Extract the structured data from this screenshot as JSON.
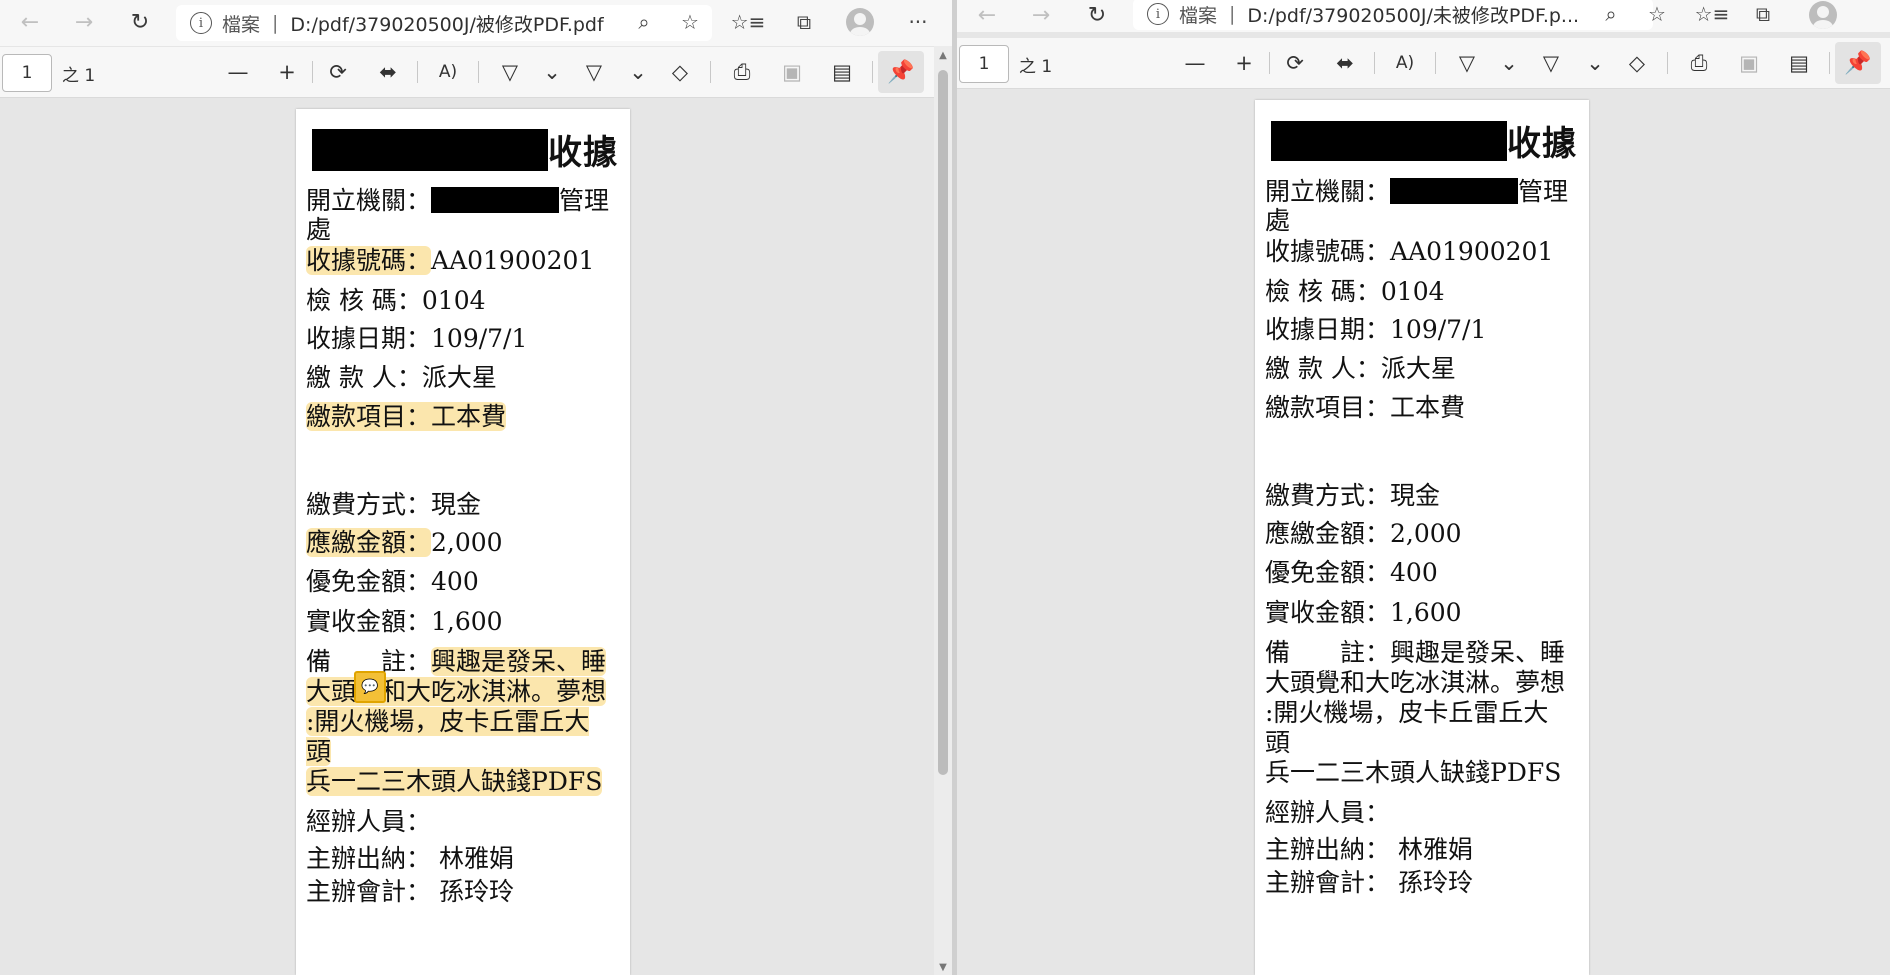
{
  "left": {
    "address": {
      "scheme": "檔案",
      "separator": "|",
      "path": "D:/pdf/379020500J/被修改PDF.pdf"
    },
    "toolbar": {
      "page_value": "1",
      "page_count": "之 1"
    },
    "doc": {
      "title": "收據",
      "agency_label": "開立機關：",
      "agency_suffix": "管理",
      "agency_wrap": "處",
      "receipt_no_label": "收據號碼：",
      "receipt_no": "AA01900201",
      "check_code_label": "檢 核 碼：",
      "check_code": "0104",
      "date_label": "收據日期：",
      "date": "109/7/1",
      "payer_label": "繳 款 人：",
      "payer": "派大星",
      "item_label": "繳款項目：",
      "item": "工本費",
      "method_label": "繳費方式：",
      "method": "現金",
      "due_label": "應繳金額：",
      "due": "2,000",
      "discount_label": "優免金額：",
      "discount": "400",
      "actual_label": "實收金額：",
      "actual": "1,600",
      "note_label": "備　　註：",
      "note_l1": "興趣是發呆、睡",
      "note_l2": "大頭覺和大吃冰淇淋。夢想",
      "note_l3": ":開火機場，皮卡丘雷丘大頭",
      "note_l4": "兵一二三木頭人缺錢PDFS",
      "handler_label": "經辦人員：",
      "cashier_label": "主辦出納：",
      "cashier": "林雅娟",
      "accountant_label": "主辦會計：",
      "accountant": "孫玲玲"
    }
  },
  "right": {
    "address": {
      "scheme": "檔案",
      "separator": "|",
      "path": "D:/pdf/379020500J/未被修改PDF.p..."
    },
    "toolbar": {
      "page_value": "1",
      "page_count": "之 1"
    },
    "doc": {
      "title": "收據",
      "agency_label": "開立機關：",
      "agency_suffix": "管理",
      "agency_wrap": "處",
      "receipt_no_label": "收據號碼：",
      "receipt_no": "AA01900201",
      "check_code_label": "檢 核 碼：",
      "check_code": "0104",
      "date_label": "收據日期：",
      "date": "109/7/1",
      "payer_label": "繳 款 人：",
      "payer": "派大星",
      "item_label": "繳款項目：",
      "item": "工本費",
      "method_label": "繳費方式：",
      "method": "現金",
      "due_label": "應繳金額：",
      "due": "2,000",
      "discount_label": "優免金額：",
      "discount": "400",
      "actual_label": "實收金額：",
      "actual": "1,600",
      "note_label": "備　　註：",
      "note_l1": "興趣是發呆、睡",
      "note_l2": "大頭覺和大吃冰淇淋。夢想",
      "note_l3": ":開火機場，皮卡丘雷丘大頭",
      "note_l4": "兵一二三木頭人缺錢PDFS",
      "handler_label": "經辦人員：",
      "cashier_label": "主辦出納：",
      "cashier": "林雅娟",
      "accountant_label": "主辦會計：",
      "accountant": "孫玲玲"
    }
  },
  "icons": {
    "back": "←",
    "forward": "→",
    "refresh": "↻",
    "zoom": "⌕",
    "favorite": "☆",
    "favorites": "☆≡",
    "collections": "⧉",
    "more": "···",
    "zoom_out": "—",
    "zoom_in": "+",
    "rotate": "⟳",
    "fit": "⬌",
    "read_aloud": "A)",
    "draw": "▽",
    "chevron": "⌄",
    "highlight": "▽",
    "erase": "◇",
    "print": "⎙",
    "save": "▣",
    "save_as": "▤",
    "pin": "📌",
    "comment": "💬"
  },
  "colors": {
    "highlight": "#fbe6ad",
    "redaction": "#000000",
    "comment_badge": "#f3c037"
  }
}
